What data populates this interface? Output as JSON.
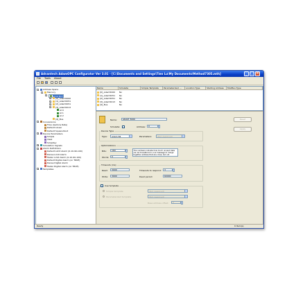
{
  "window": {
    "title": "Advantech AdamOPC Configurator Ver 3.01 - [C:\\Documents and Settings\\Tien Lu\\My Documents\\Method7305.mth]",
    "min_glyph": "_",
    "max_glyph": "□",
    "close_glyph": "×"
  },
  "menu": [
    "File",
    "Tools",
    "About"
  ],
  "tree": [
    {
      "label": "Address Space",
      "icon": "address-space-icon",
      "level": 0,
      "expander": "−"
    },
    {
      "label": "Mercury",
      "icon": "folder-icon",
      "level": 1,
      "expander": "−"
    },
    {
      "label": "Local Port",
      "icon": "port-icon",
      "level": 2,
      "expander": "−",
      "selected": true
    },
    {
      "label": "[0]_Adam5000",
      "icon": "device-icon",
      "level": 3,
      "expander": "+"
    },
    {
      "label": "[1]_Adam5051",
      "icon": "device-icon",
      "level": 3,
      "expander": "+"
    },
    {
      "label": "[2]_Adam5051",
      "icon": "device-icon",
      "level": 3,
      "expander": "+"
    },
    {
      "label": "[3]_Adam5013",
      "icon": "device-icon",
      "level": 3,
      "expander": "−"
    },
    {
      "label": "AI 0",
      "icon": "tag-icon",
      "level": 4
    },
    {
      "label": "AI 1",
      "icon": "tag-icon",
      "level": 4
    },
    {
      "label": "AI 2",
      "icon": "tag-icon",
      "level": 4
    },
    {
      "label": "[4]_Bus",
      "icon": "device-icon",
      "level": 3
    },
    {
      "label": "Conversions",
      "icon": "conversions-icon",
      "level": 0,
      "expander": "−"
    },
    {
      "label": "Flow (Gallons Rate)",
      "icon": "conversion-icon",
      "level": 1
    },
    {
      "label": "Default Linear",
      "icon": "conversion-icon",
      "level": 1
    },
    {
      "label": "Default Square Root",
      "icon": "conversion-icon",
      "level": 1
    },
    {
      "label": "Device Parameters",
      "icon": "parameters-icon",
      "level": 0,
      "expander": "−"
    },
    {
      "label": "Simple",
      "icon": "parameter-icon",
      "level": 1
    },
    {
      "label": "Ideal",
      "icon": "parameter-icon",
      "level": 1
    },
    {
      "label": "SimpDev",
      "icon": "parameter-icon",
      "level": 1
    },
    {
      "label": "Simulation Signals",
      "icon": "simulation-icon",
      "level": 0,
      "expander": "+"
    },
    {
      "label": "Alarm Definitions",
      "icon": "alarm-icon",
      "level": 0,
      "expander": "−"
    },
    {
      "label": "Default Limit Alarm (0-10-90-100)",
      "icon": "alarm-item-icon",
      "level": 1
    },
    {
      "label": "Dense Limit Alarm",
      "icon": "alarm-item-icon",
      "level": 1
    },
    {
      "label": "Faster Limit Alarm (0-10-90-100)",
      "icon": "alarm-item-icon",
      "level": 1
    },
    {
      "label": "Default Digital Alarm (on TRUE)",
      "icon": "alarm-item-icon",
      "level": 1
    },
    {
      "label": "Dense Digital Alarm",
      "icon": "alarm-item-icon",
      "level": 1
    },
    {
      "label": "Faster Digital Alarm (on TRUE)",
      "icon": "alarm-item-icon",
      "level": 1
    },
    {
      "label": "Templates",
      "icon": "templates-icon",
      "level": 0,
      "expander": "+"
    }
  ],
  "list": {
    "columns": [
      "Name",
      "Simulate",
      "Simple Template",
      "Parameterized ...",
      "Location Type",
      "Starting Address",
      "ModBus Type"
    ],
    "rows": [
      [
        "[0]_Adam5000",
        "No"
      ],
      [
        "[1]_Adam5051",
        "No"
      ],
      [
        "[2]_Adam5051",
        "No"
      ],
      [
        "[3]_Adam5013",
        "No"
      ],
      [
        "[4]_Bus",
        "No"
      ]
    ]
  },
  "props": {
    "name_label": "Name:",
    "name_value": "ADAM_5000",
    "simulate_label": "Simulate:",
    "address_label": "Address:",
    "address_value": "0",
    "device_type_group": "Device Type",
    "type_label": "Type:",
    "type_value": "Adam 84",
    "parameters_label": "Parameters:",
    "parameters_value": "(Not Assigned)",
    "optimizations_group": "Optimizations",
    "bits_label": "Bits:",
    "bits_value": "160",
    "words_label": "Words:",
    "words_value": "0",
    "optim_note": "The numbers indicate how much unused data can be transferred in one message to merge together address that are close, but not adjacent.",
    "timeouts_group": "Timeouts (ms)",
    "read_label": "Read:",
    "read_value": "3000",
    "write_label": "Write:",
    "write_value": "3000",
    "timeouts_resp_label": "Timeouts to respond:",
    "timeouts_resp_value": "3",
    "dead_label": "Dead period:",
    "dead_value": "60000",
    "use_template_label": "Use template",
    "simple_template_label": "Simple template",
    "simple_template_value": "(Not Assigned)",
    "param_template_label": "Parameterized template",
    "param_template_value": "(Not Assigned)",
    "base_address_label": "Base address offset:",
    "base_address_value": "0",
    "reset_button": "Reset",
    "apply_button": "Apply"
  },
  "status": {
    "left": "Ready",
    "right": "9 Item(s)"
  },
  "colors": {
    "title_bar": "#0a3fc7",
    "selection": "#316ac5",
    "folder": "#f0c34c"
  }
}
